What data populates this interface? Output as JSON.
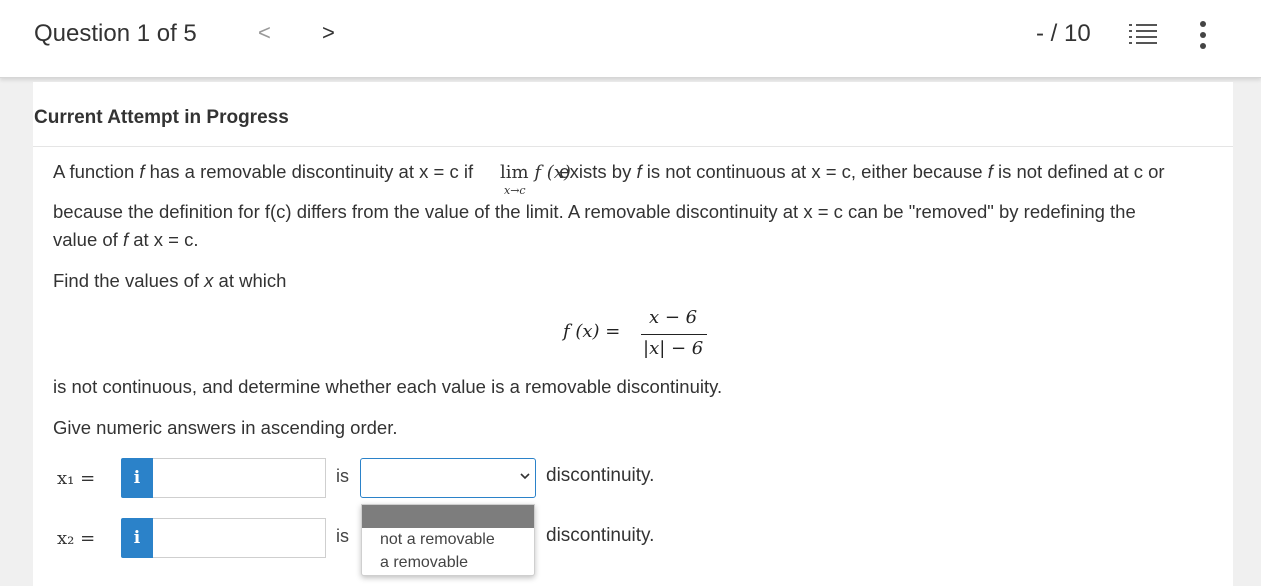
{
  "header": {
    "question_label": "Question 1 of 5",
    "prev_glyph": "<",
    "next_glyph": ">",
    "score": "- / 10",
    "icons": [
      "list-numbered-icon",
      "more-vertical-icon"
    ]
  },
  "attempt_heading": "Current Attempt in Progress",
  "problem": {
    "line1_pre": "A function ",
    "line1_f": "f",
    "line1_mid": " has a removable discontinuity at x = c if ",
    "lim_text": "lim",
    "lim_fx": "f (x)",
    "lim_sub": "x→c",
    "line1_post": " exists by ",
    "line1_f2": "f",
    "line1_post2": " is not continuous at x = c, either because ",
    "line1_f3": "f",
    "line1_post3": " is not defined at c or",
    "line2": "because the definition for f(c) differs from the value of the limit. A removable discontinuity at x = c can be \"removed\" by redefining the",
    "line3_pre": "value of ",
    "line3_f": "f",
    "line3_post": " at x = c.",
    "find_pre": "Find the values of ",
    "find_x": "x",
    "find_post": " at which",
    "formula_lhs": "f (x) =",
    "formula_num": "x − 6",
    "formula_den": "|x| − 6",
    "not_continuous": "is not continuous, and determine whether each value is a removable discontinuity.",
    "instruction": "Give numeric answers in ascending order."
  },
  "answers": [
    {
      "label": "x₁ =",
      "info": "i",
      "value": "",
      "is": "is",
      "select_value": "",
      "suffix": "discontinuity."
    },
    {
      "label": "x₂ =",
      "info": "i",
      "value": "",
      "is": "is",
      "select_value": "",
      "suffix": "discontinuity."
    }
  ],
  "dropdown": {
    "options": [
      "",
      "not a removable",
      "a removable"
    ]
  },
  "colors": {
    "accent": "#2b82c9",
    "topbar": "#ffffff",
    "background": "#f0f0f0",
    "selected_option": "#7d7d7d"
  }
}
